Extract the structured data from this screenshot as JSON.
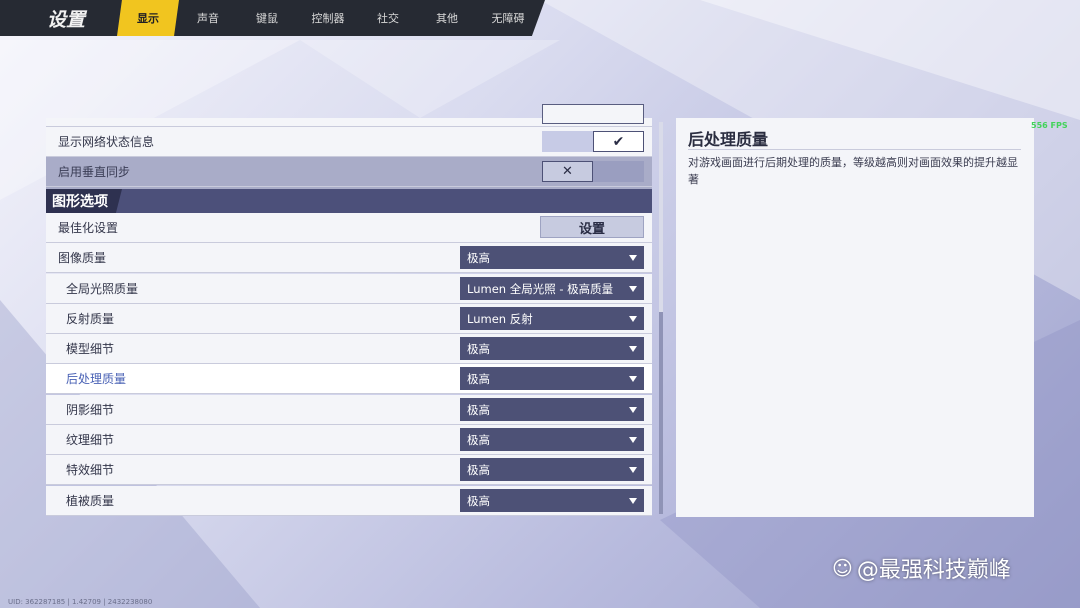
{
  "app_title": "设置",
  "tabs": [
    "显示",
    "声音",
    "键鼠",
    "控制器",
    "社交",
    "其他",
    "无障碍"
  ],
  "active_tab": "显示",
  "rows_top": [
    {
      "label": "显示网络状态信息",
      "toggle": "on"
    },
    {
      "label": "启用垂直同步",
      "toggle": "off"
    }
  ],
  "section": {
    "title": "图形选项"
  },
  "optimize": {
    "label": "最佳化设置",
    "button": "设置"
  },
  "graphics": [
    {
      "label": "图像质量",
      "value": "极高",
      "indent": false
    },
    {
      "label": "全局光照质量",
      "value": "Lumen 全局光照 - 极高质量",
      "indent": true
    },
    {
      "label": "反射质量",
      "value": "Lumen 反射",
      "indent": true
    },
    {
      "label": "模型细节",
      "value": "极高",
      "indent": true
    },
    {
      "label": "后处理质量",
      "value": "极高",
      "indent": true,
      "selected": true
    },
    {
      "label": "阴影细节",
      "value": "极高",
      "indent": true
    },
    {
      "label": "纹理细节",
      "value": "极高",
      "indent": true
    },
    {
      "label": "特效细节",
      "value": "极高",
      "indent": true
    },
    {
      "label": "植被质量",
      "value": "极高",
      "indent": true
    }
  ],
  "description": {
    "title": "后处理质量",
    "text": "对游戏画面进行后期处理的质量，等级越高则对画面效果的提升越显著"
  },
  "fps": "556 FPS",
  "footer_info": "UID: 362287185 | 1.42709 | 2432238080",
  "watermark": "@最强科技巅峰",
  "colors": {
    "accent": "#f1c51f",
    "dropdown": "#4d5176",
    "topbar": "#262a33"
  }
}
